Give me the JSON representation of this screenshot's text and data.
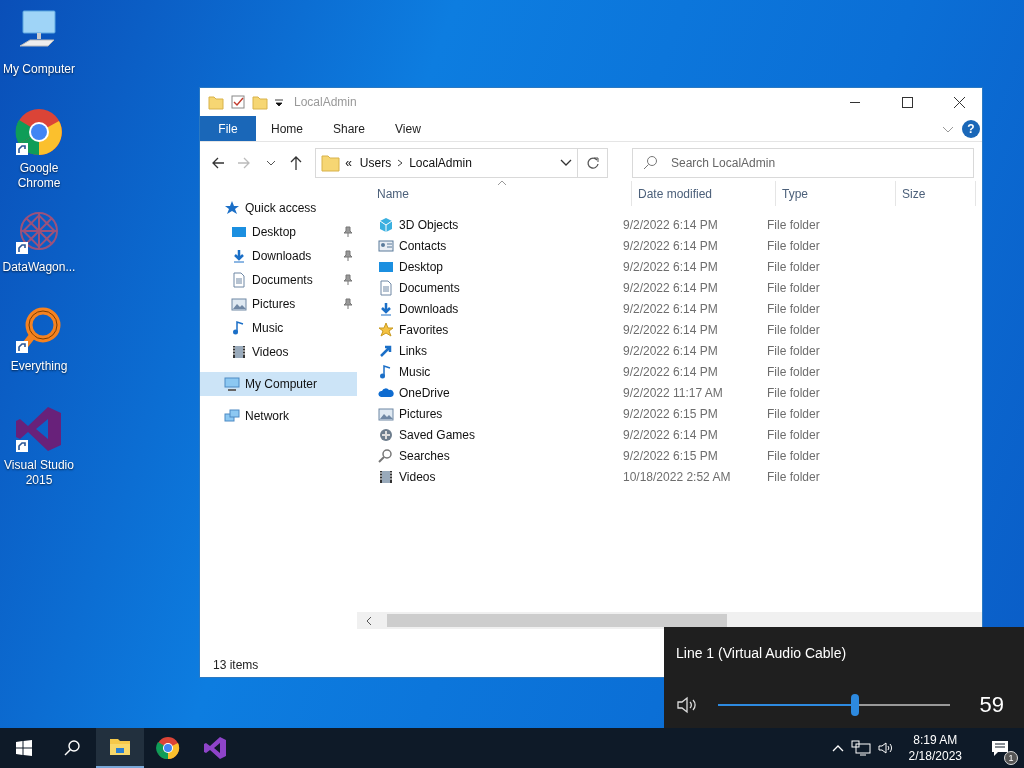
{
  "desktop_icons": [
    {
      "label": "My Computer",
      "shortcut": false
    },
    {
      "label": "Google Chrome",
      "shortcut": true
    },
    {
      "label": "DataWagon...",
      "shortcut": true
    },
    {
      "label": "Everything",
      "shortcut": true
    },
    {
      "label": "Visual Studio 2015",
      "shortcut": true
    }
  ],
  "explorer": {
    "title": "LocalAdmin",
    "ribbon_tabs": [
      {
        "label": "File",
        "selected": true
      },
      {
        "label": "Home",
        "selected": false
      },
      {
        "label": "Share",
        "selected": false
      },
      {
        "label": "View",
        "selected": false
      }
    ],
    "help": "?",
    "address": {
      "overflow": "«",
      "crumbs": [
        "Users",
        "LocalAdmin"
      ]
    },
    "search": {
      "placeholder": "Search LocalAdmin"
    },
    "nav": [
      {
        "label": "Quick access",
        "selected": false,
        "children": [
          {
            "label": "Desktop",
            "pinned": true
          },
          {
            "label": "Downloads",
            "pinned": true
          },
          {
            "label": "Documents",
            "pinned": true
          },
          {
            "label": "Pictures",
            "pinned": true
          },
          {
            "label": "Music",
            "pinned": false
          },
          {
            "label": "Videos",
            "pinned": false
          }
        ]
      },
      {
        "label": "My Computer",
        "selected": true
      },
      {
        "label": "Network",
        "selected": false
      }
    ],
    "columns": [
      "Name",
      "Date modified",
      "Type",
      "Size"
    ],
    "rows": [
      {
        "name": "3D Objects",
        "date": "9/2/2022 6:14 PM",
        "type": "File folder"
      },
      {
        "name": "Contacts",
        "date": "9/2/2022 6:14 PM",
        "type": "File folder"
      },
      {
        "name": "Desktop",
        "date": "9/2/2022 6:14 PM",
        "type": "File folder"
      },
      {
        "name": "Documents",
        "date": "9/2/2022 6:14 PM",
        "type": "File folder"
      },
      {
        "name": "Downloads",
        "date": "9/2/2022 6:14 PM",
        "type": "File folder"
      },
      {
        "name": "Favorites",
        "date": "9/2/2022 6:14 PM",
        "type": "File folder"
      },
      {
        "name": "Links",
        "date": "9/2/2022 6:14 PM",
        "type": "File folder"
      },
      {
        "name": "Music",
        "date": "9/2/2022 6:14 PM",
        "type": "File folder"
      },
      {
        "name": "OneDrive",
        "date": "9/2/2022 11:17 AM",
        "type": "File folder"
      },
      {
        "name": "Pictures",
        "date": "9/2/2022 6:15 PM",
        "type": "File folder"
      },
      {
        "name": "Saved Games",
        "date": "9/2/2022 6:14 PM",
        "type": "File folder"
      },
      {
        "name": "Searches",
        "date": "9/2/2022 6:15 PM",
        "type": "File folder"
      },
      {
        "name": "Videos",
        "date": "10/18/2022 2:52 AM",
        "type": "File folder"
      }
    ],
    "status": "13 items"
  },
  "volume_flyout": {
    "device": "Line 1 (Virtual Audio Cable)",
    "level": 0.59,
    "reading": "59"
  },
  "taskbar": {
    "apps": [
      {
        "selected": true
      },
      {
        "selected": false
      },
      {
        "selected": false
      }
    ],
    "time": "8:19 AM",
    "date": "2/18/2023",
    "notifications": "1"
  }
}
